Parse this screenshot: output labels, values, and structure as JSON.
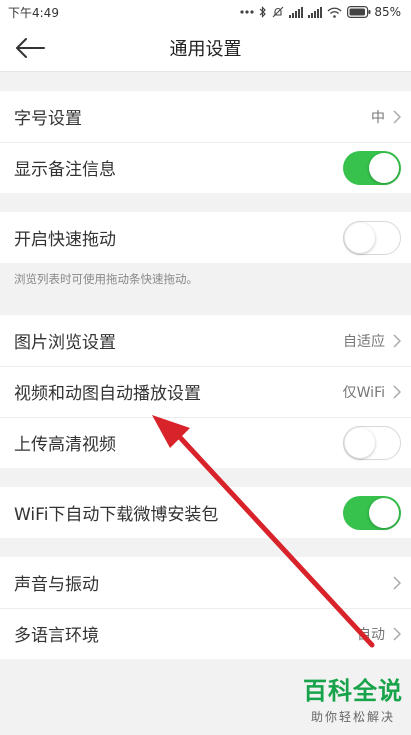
{
  "status": {
    "time": "下午4:49",
    "battery": "85%"
  },
  "header": {
    "title": "通用设置"
  },
  "group1": [
    {
      "label": "字号设置",
      "value": "中"
    },
    {
      "label": "显示备注信息",
      "toggle": "on"
    }
  ],
  "group2": [
    {
      "label": "开启快速拖动",
      "toggle": "off"
    }
  ],
  "hint": "浏览列表时可使用拖动条快速拖动。",
  "group3": [
    {
      "label": "图片浏览设置",
      "value": "自适应"
    },
    {
      "label": "视频和动图自动播放设置",
      "value": "仅WiFi"
    },
    {
      "label": "上传高清视频",
      "toggle": "off"
    }
  ],
  "group4": [
    {
      "label": "WiFi下自动下载微博安装包",
      "toggle": "on"
    }
  ],
  "group5": [
    {
      "label": "声音与振动"
    },
    {
      "label": "多语言环境",
      "value": "自动"
    }
  ],
  "watermark": {
    "title": "百科全说",
    "subtitle": "助你轻松解决"
  },
  "colors": {
    "toggle_on": "#36c24c",
    "annotation_arrow": "#d9232a"
  }
}
